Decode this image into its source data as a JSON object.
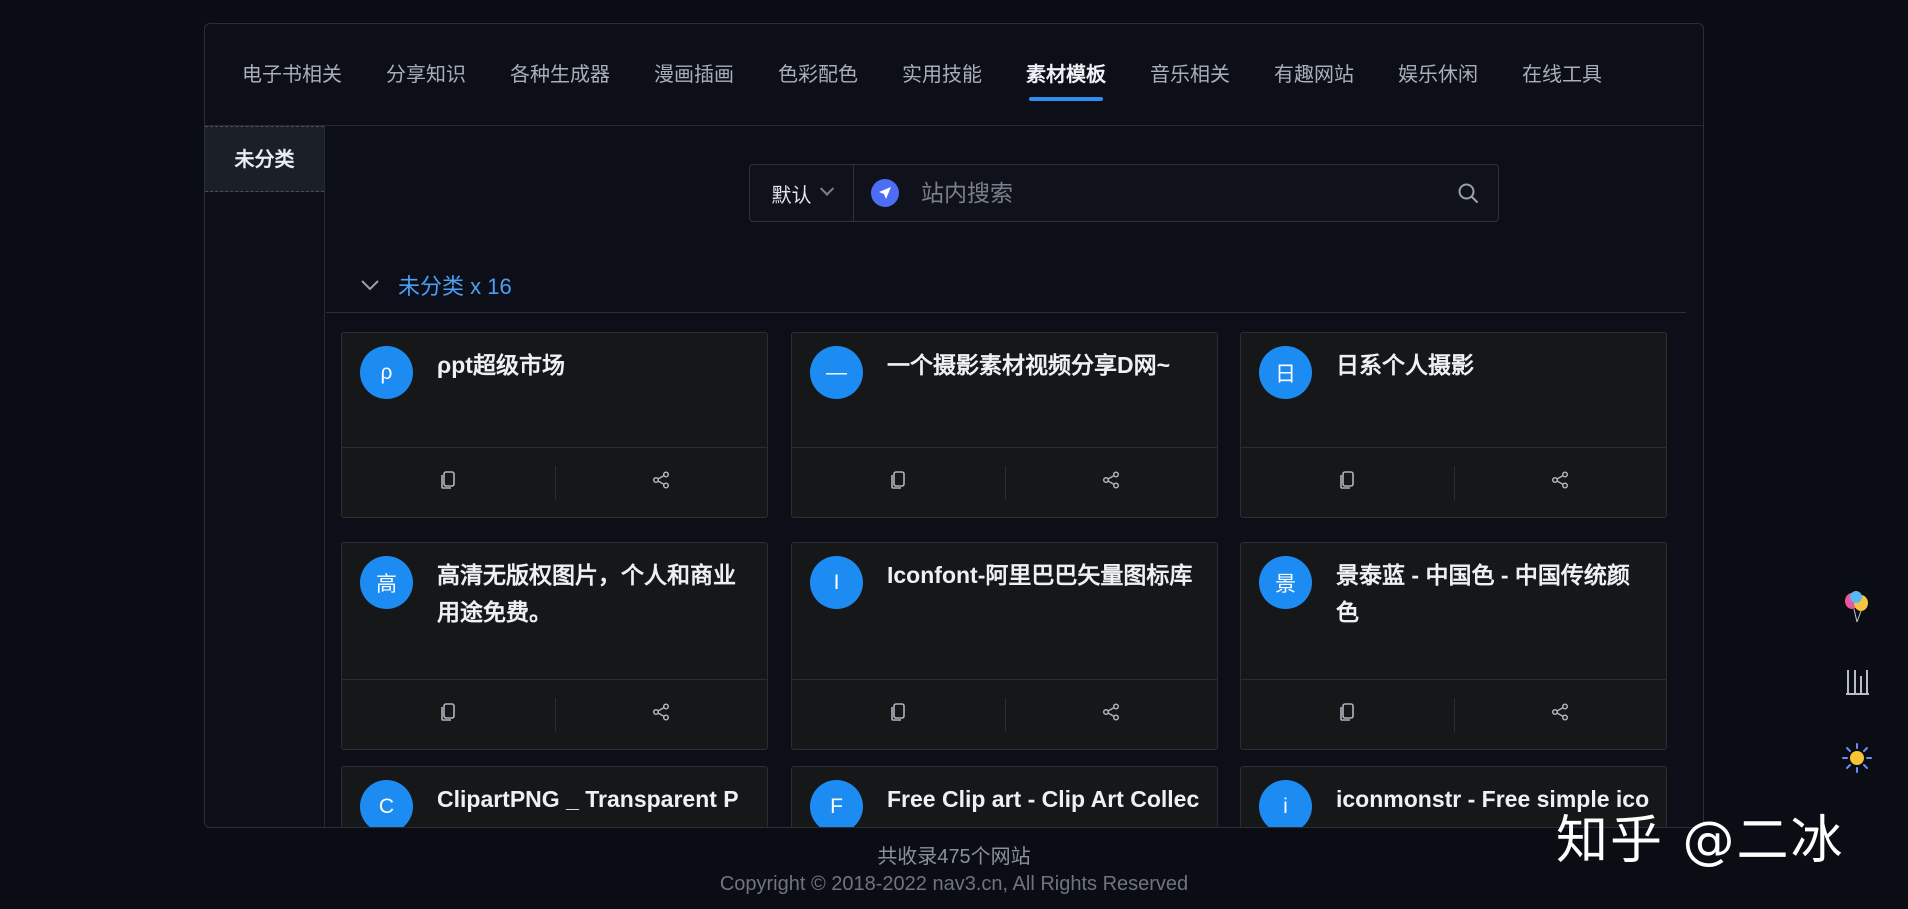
{
  "nav": {
    "tabs": [
      {
        "label": "电子书相关"
      },
      {
        "label": "分享知识"
      },
      {
        "label": "各种生成器"
      },
      {
        "label": "漫画插画"
      },
      {
        "label": "色彩配色"
      },
      {
        "label": "实用技能"
      },
      {
        "label": "素材模板",
        "active": true
      },
      {
        "label": "音乐相关"
      },
      {
        "label": "有趣网站"
      },
      {
        "label": "娱乐休闲"
      },
      {
        "label": "在线工具"
      }
    ]
  },
  "sidebar": {
    "items": [
      {
        "label": "未分类"
      }
    ]
  },
  "search": {
    "engine": "默认",
    "placeholder": "站内搜索"
  },
  "section": {
    "title": "未分类 x 16"
  },
  "cards": [
    {
      "avatar": "ρ",
      "title": "ρpt超级市场"
    },
    {
      "avatar": "—",
      "title": "一个摄影素材视频分享D网~"
    },
    {
      "avatar": "日",
      "title": "日系个人摄影"
    },
    {
      "avatar": "高",
      "title": "高清无版权图片，个人和商业用途免费。"
    },
    {
      "avatar": "I",
      "title": "Iconfont-阿里巴巴矢量图标库"
    },
    {
      "avatar": "景",
      "title": "景泰蓝 - 中国色 - 中国传统颜色"
    },
    {
      "avatar": "C",
      "title": "ClipartPNG _ Transparent P"
    },
    {
      "avatar": "F",
      "title": "Free Clip art - Clip Art Collec"
    },
    {
      "avatar": "i",
      "title": "iconmonstr - Free simple ico"
    }
  ],
  "footer": {
    "count": "共收录475个网站",
    "copyright": "Copyright © 2018-2022 nav3.cn, All Rights Reserved"
  },
  "watermark": "知乎 @二冰",
  "colors": {
    "accent": "#2f8df0",
    "avatar": "#1c8cf3",
    "section_title": "#4d9ef5"
  },
  "icons": {
    "card_actions": [
      "copy-icon",
      "share-icon"
    ],
    "float_tools": [
      "balloon-icon",
      "bookmark-icon",
      "sun-icon"
    ]
  }
}
